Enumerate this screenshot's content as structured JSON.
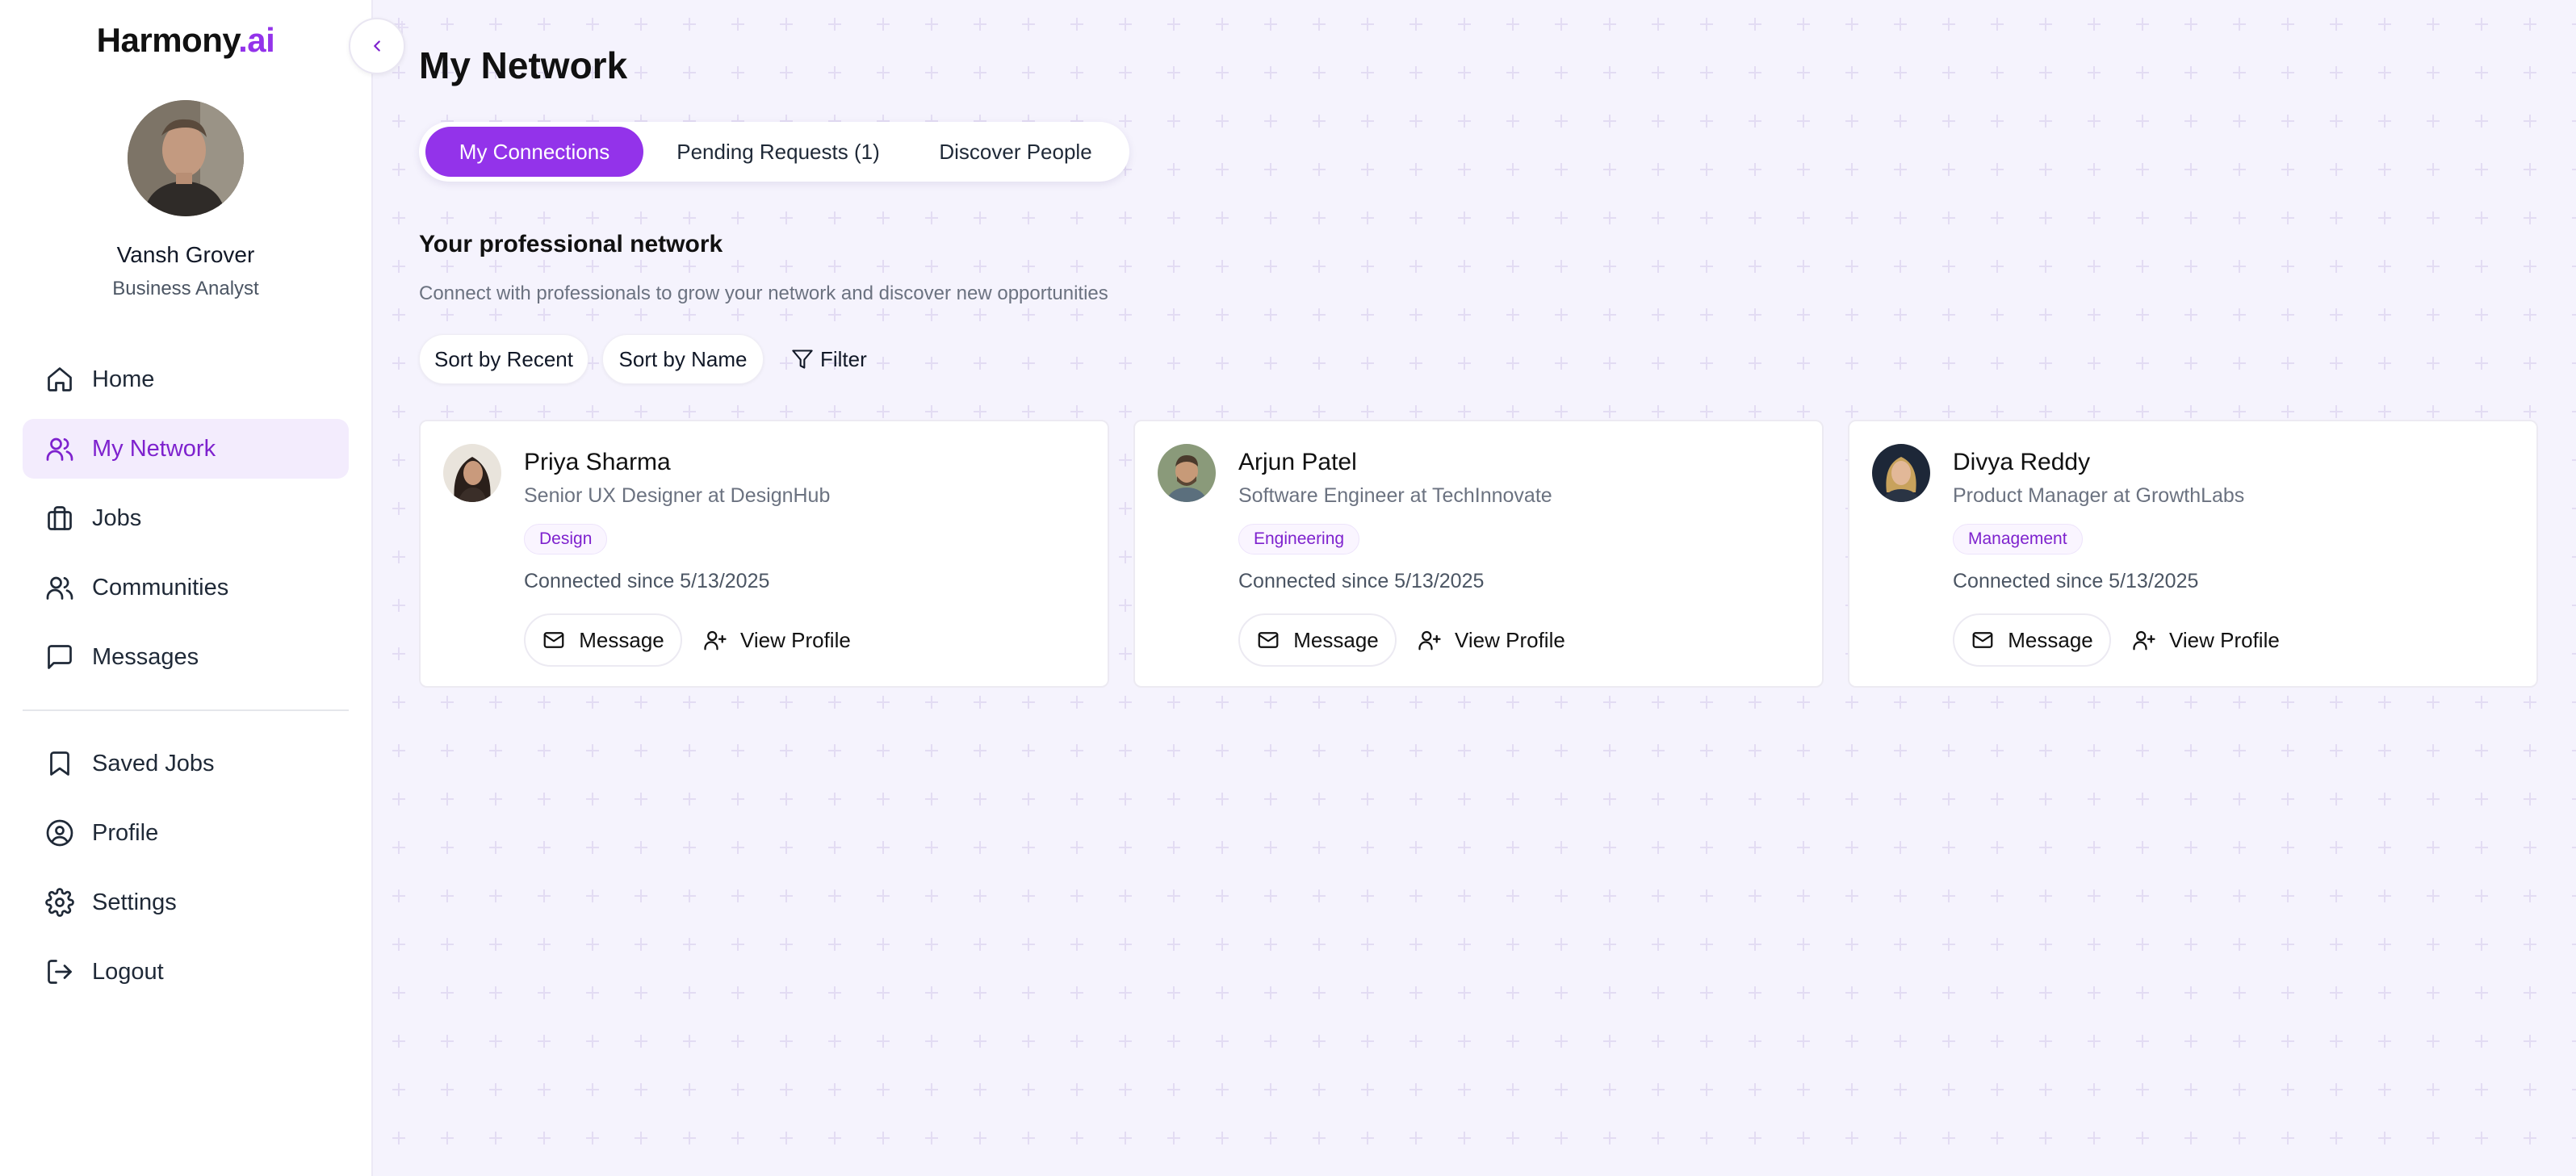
{
  "brand": {
    "name": "Harmony",
    "suffix": ".ai",
    "accent_color": "#9333ea"
  },
  "profile": {
    "name": "Vansh Grover",
    "role": "Business Analyst"
  },
  "sidebar": {
    "items": [
      {
        "label": "Home",
        "icon": "home-icon",
        "active": false
      },
      {
        "label": "My Network",
        "icon": "users-icon",
        "active": true
      },
      {
        "label": "Jobs",
        "icon": "briefcase-icon",
        "active": false
      },
      {
        "label": "Communities",
        "icon": "users-icon",
        "active": false
      },
      {
        "label": "Messages",
        "icon": "message-square-icon",
        "active": false
      }
    ],
    "secondary": [
      {
        "label": "Saved Jobs",
        "icon": "bookmark-icon"
      },
      {
        "label": "Profile",
        "icon": "user-circle-icon"
      },
      {
        "label": "Settings",
        "icon": "gear-icon"
      },
      {
        "label": "Logout",
        "icon": "logout-icon"
      }
    ]
  },
  "page": {
    "title": "My Network",
    "tabs": [
      {
        "label": "My Connections",
        "active": true
      },
      {
        "label": "Pending Requests (1)",
        "active": false
      },
      {
        "label": "Discover People",
        "active": false
      }
    ],
    "section_title": "Your professional network",
    "section_subtitle": "Connect with professionals to grow your network and discover new opportunities",
    "sort_recent": "Sort by Recent",
    "sort_name": "Sort by Name",
    "filter": "Filter"
  },
  "connections": [
    {
      "name": "Priya Sharma",
      "title": "Senior UX Designer at DesignHub",
      "tag": "Design",
      "since": "Connected since 5/13/2025",
      "message_label": "Message",
      "view_label": "View Profile"
    },
    {
      "name": "Arjun Patel",
      "title": "Software Engineer at TechInnovate",
      "tag": "Engineering",
      "since": "Connected since 5/13/2025",
      "message_label": "Message",
      "view_label": "View Profile"
    },
    {
      "name": "Divya Reddy",
      "title": "Product Manager at GrowthLabs",
      "tag": "Management",
      "since": "Connected since 5/13/2025",
      "message_label": "Message",
      "view_label": "View Profile"
    }
  ]
}
